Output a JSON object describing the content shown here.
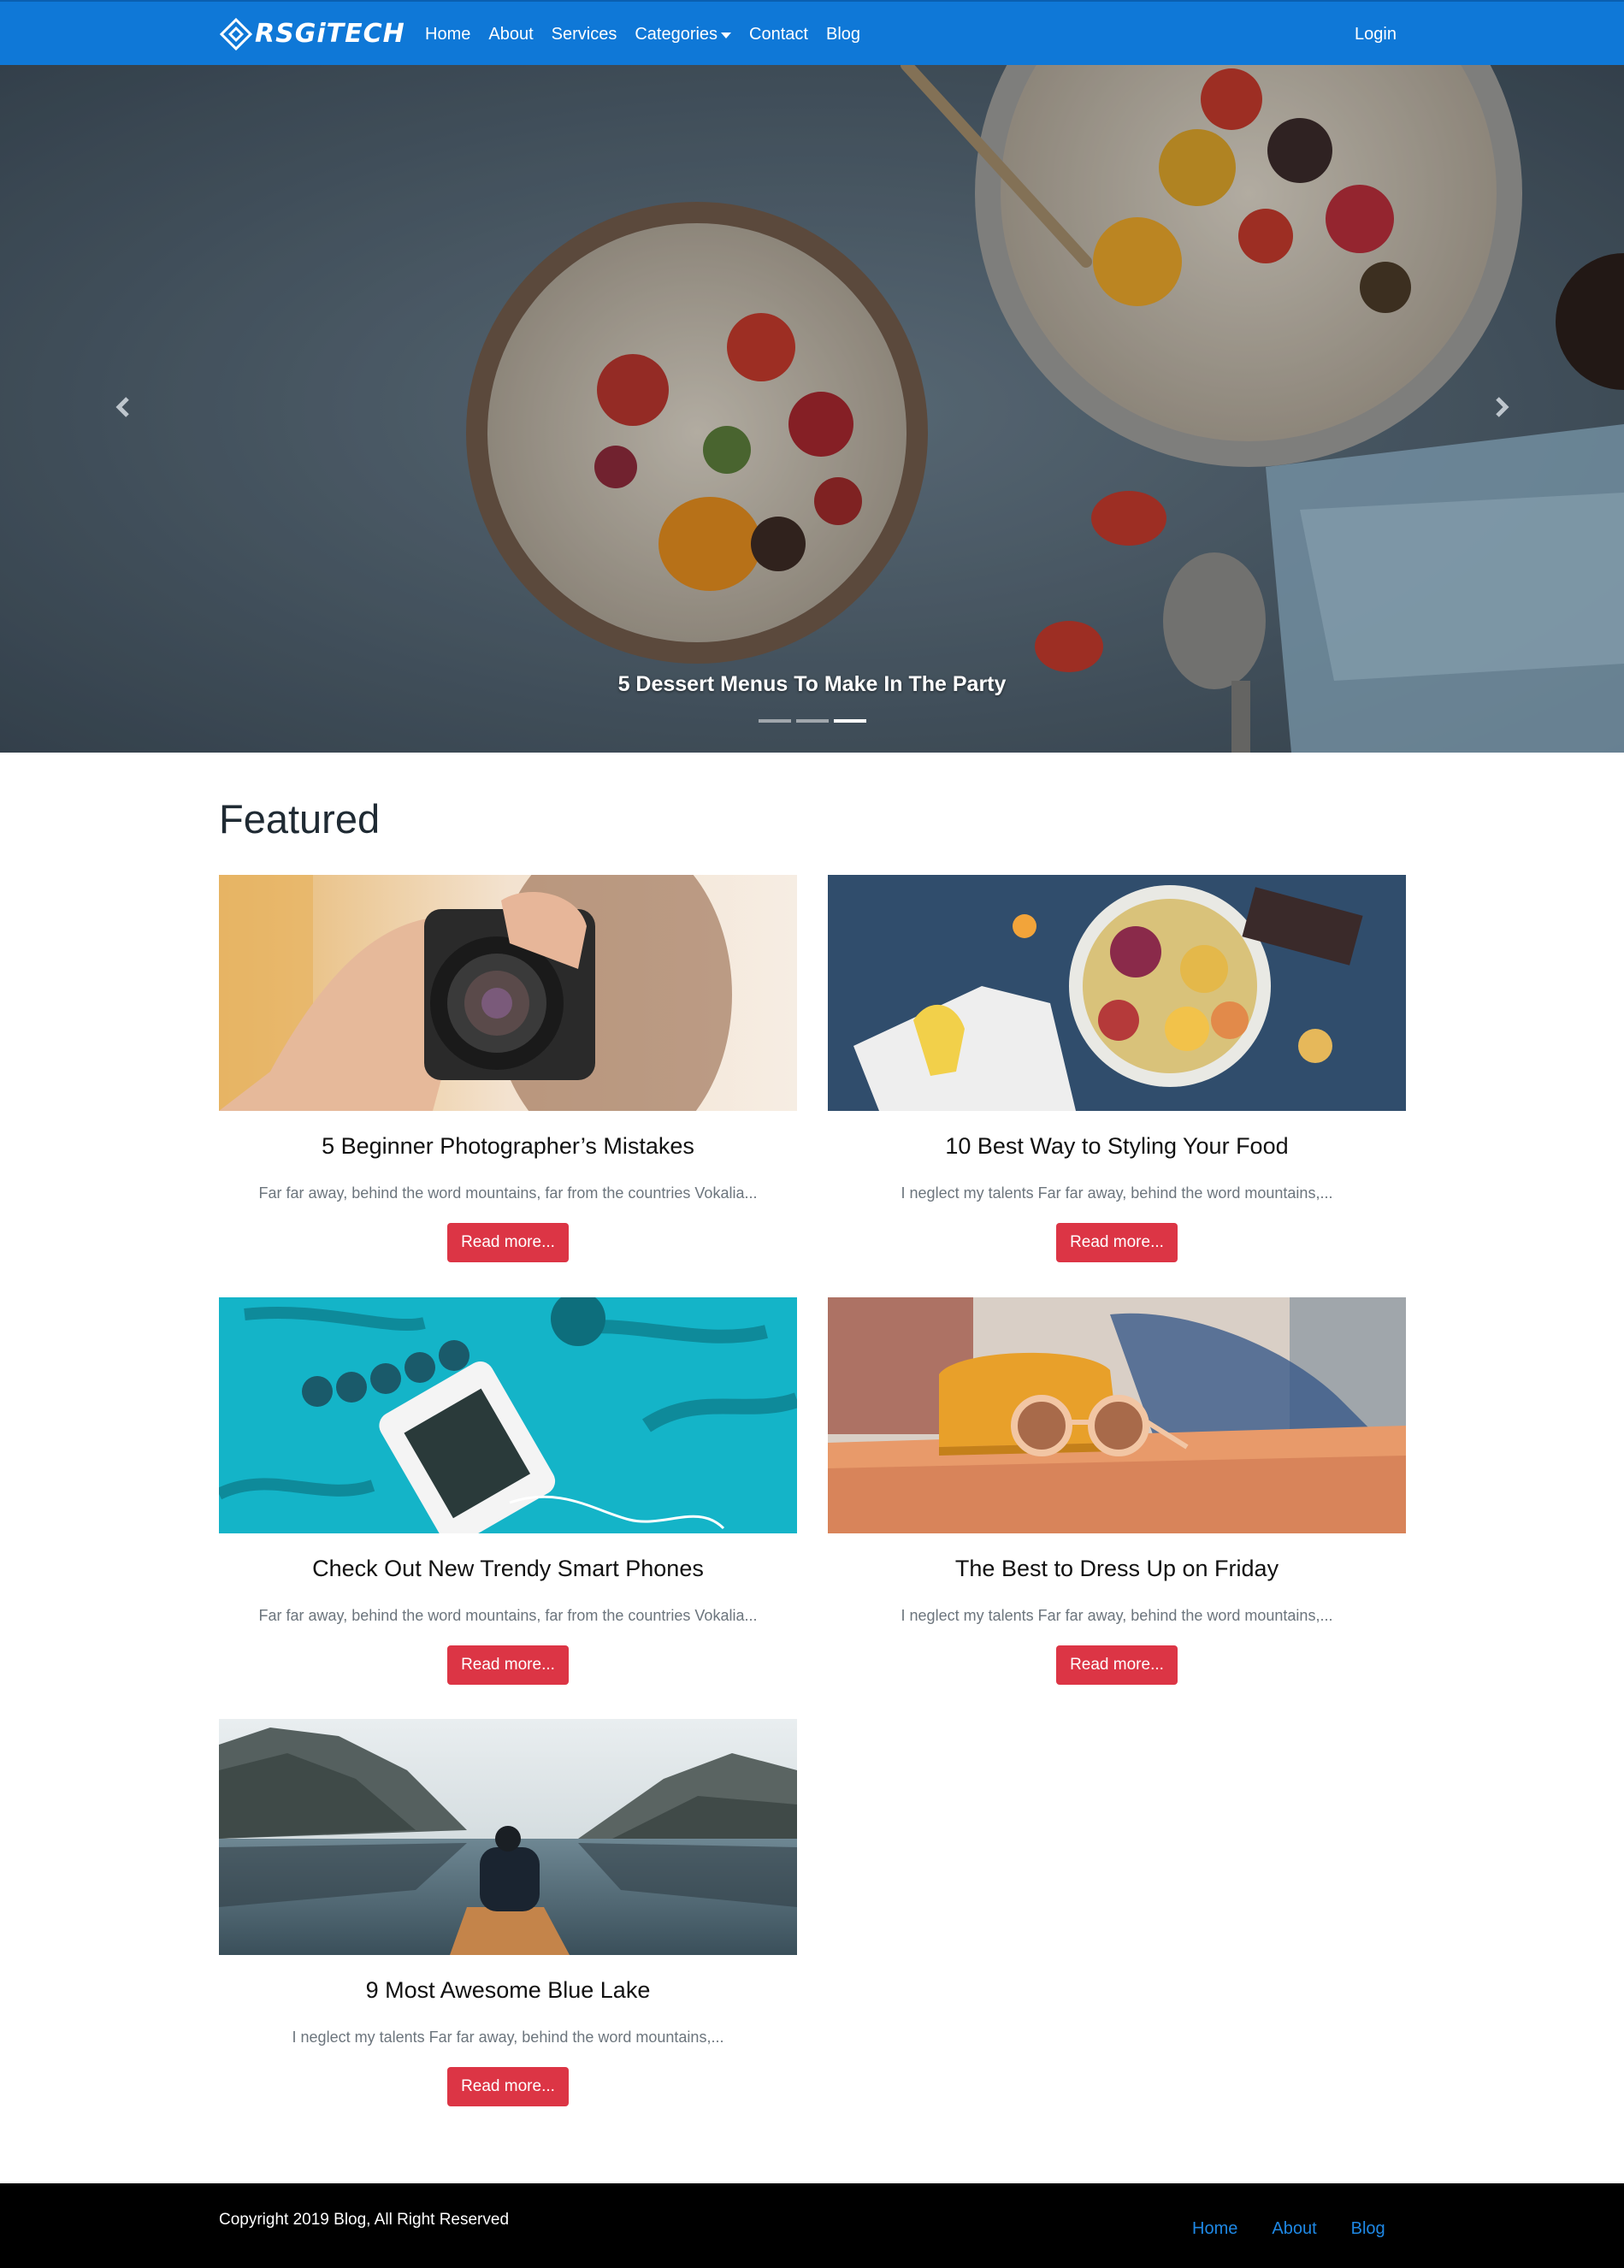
{
  "brand": {
    "name": "RSGiTECH"
  },
  "nav": {
    "links": [
      "Home",
      "About",
      "Services",
      "Categories",
      "Contact",
      "Blog"
    ],
    "login": "Login"
  },
  "hero": {
    "caption": "5 Dessert Menus To Make In The Party",
    "slides": 3,
    "active_slide": 3
  },
  "featured": {
    "title": "Featured",
    "button_label": "Read more...",
    "posts": [
      {
        "title": "5 Beginner Photographer’s Mistakes",
        "excerpt": "Far far away, behind the word mountains, far from the countries Vokalia..."
      },
      {
        "title": "10 Best Way to Styling Your Food",
        "excerpt": "I neglect my talents Far far away, behind the word mountains,..."
      },
      {
        "title": "Check Out New Trendy Smart Phones",
        "excerpt": "Far far away, behind the word mountains, far from the countries Vokalia..."
      },
      {
        "title": "The Best to Dress Up on Friday",
        "excerpt": "I neglect my talents Far far away, behind the word mountains,..."
      },
      {
        "title": "9 Most Awesome Blue Lake",
        "excerpt": "I neglect my talents Far far away, behind the word mountains,..."
      }
    ]
  },
  "footer": {
    "copyright": "Copyright 2019 Blog, All Right Reserved",
    "links": [
      "Home",
      "About",
      "Blog"
    ]
  },
  "colors": {
    "navbar": "#0f78d7",
    "button": "#dc3545",
    "footer": "#000000",
    "footer_link": "#1e88e5"
  }
}
